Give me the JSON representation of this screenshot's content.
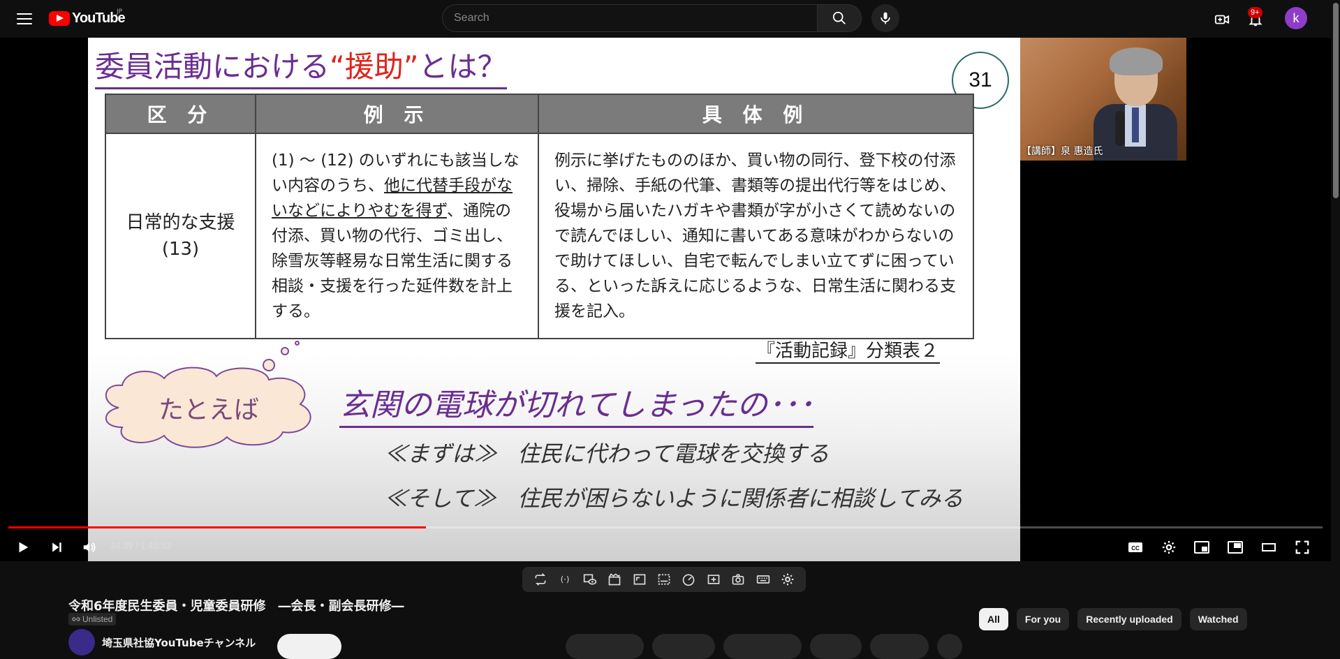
{
  "app": {
    "logo_text": "YouTube",
    "country": "JP"
  },
  "search": {
    "placeholder": "Search"
  },
  "notifications": {
    "badge": "9+"
  },
  "account": {
    "avatar_letter": "k",
    "avatar_color": "#8e3dc8"
  },
  "slide": {
    "title_pre": "委員活動における",
    "title_highlight": "“援助”",
    "title_post": "とは？",
    "number": "31",
    "table": {
      "headers": [
        "区 分",
        "例 示",
        "具 体 例"
      ],
      "category": "日常的な支援",
      "category_count": "(13)",
      "example_pre": "(1) ～ (12) のいずれにも該当しない内容のうち、",
      "example_underlined": "他に代替手段がないなどによりやむを得ず",
      "example_post": "、通院の付添、買い物の代行、ゴミ出し、除雪灰等軽易な日常生活に関する相談・支援を行った延件数を計上する。",
      "concrete": "例示に挙げたもののほか、買い物の同行、登下校の付添い、掃除、手紙の代筆、書類等の提出代行等をはじめ、役場から届いたハガキや書類が字が小さくて読めないので読んでほしい、通知に書いてある意味がわからないので助けてほしい、自宅で転んでしまい立てずに困っている、といった訴えに応じるような、日常生活に関わる支援を記入。"
    },
    "source": "『活動記録』分類表２",
    "cloud_text": "たとえば",
    "example_line": "玄関の電球が切れてしまったの･･･",
    "steps": [
      {
        "label": "≪まずは≫",
        "text": "住民に代わって電球を交換する"
      },
      {
        "label": "≪そして≫",
        "text": "住民が困らないように関係者に相談してみる"
      }
    ]
  },
  "speaker": {
    "label": "【講師】泉 惠造氏"
  },
  "player": {
    "current_time": "34:39",
    "duration": "1:48:53",
    "time_display": "34:39 / 1:48:53",
    "progress": 0.318,
    "progress_color": "#ff0000"
  },
  "extension_toolbar": {
    "icons": [
      "loop-icon",
      "broadcast-icon",
      "watch-icon",
      "clapper-icon",
      "resize-icon",
      "subtitles-icon",
      "speed-icon",
      "add-icon",
      "camera-icon",
      "keyboard-icon",
      "settings-icon"
    ]
  },
  "video": {
    "title": "令和6年度民生委員・児童委員研修　―会長・副会長研修―",
    "visibility": "Unlisted",
    "channel_name": "埼玉県社協YouTubeチャンネル"
  },
  "chips": [
    {
      "label": "All",
      "active": true
    },
    {
      "label": "For you",
      "active": false
    },
    {
      "label": "Recently uploaded",
      "active": false
    },
    {
      "label": "Watched",
      "active": false
    }
  ]
}
